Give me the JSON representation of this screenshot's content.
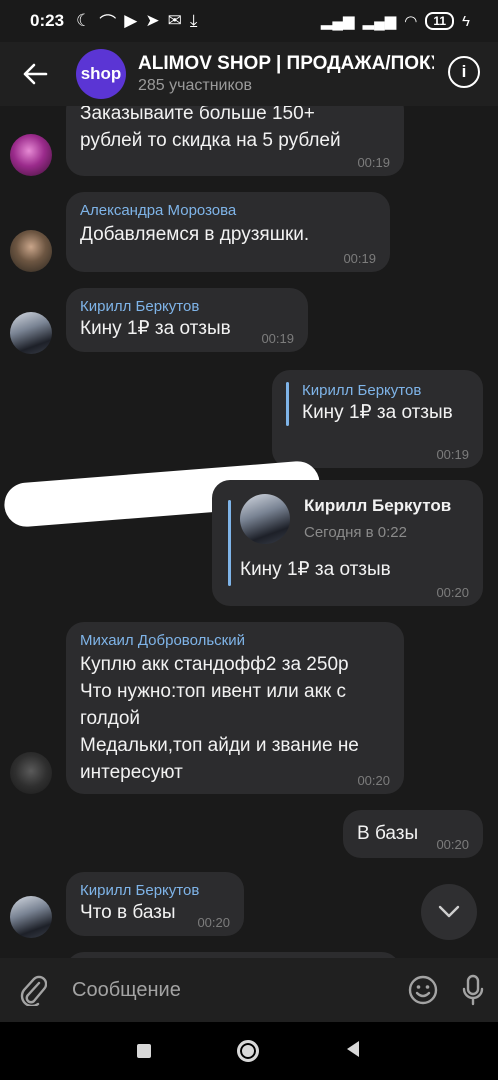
{
  "status_bar": {
    "time": "0:23",
    "battery": "11"
  },
  "header": {
    "avatar_text": "shop",
    "title": "ALIMOV SHOP | ПРОДАЖА/ПОКУПКА",
    "subtitle": "285 участников"
  },
  "messages": [
    {
      "text": "Заказываите больше 150+\nрублей то скидка на 5 рублей",
      "time": "00:19"
    },
    {
      "sender": "Александра Морозова",
      "text": "Добавляемся в друзяшки.",
      "time": "00:19"
    },
    {
      "sender": "Кирилл Беркутов",
      "text": "Кину 1₽ за отзыв",
      "time": "00:19"
    },
    {
      "quote_sender": "Кирилл Беркутов",
      "quote_text": "Кину 1₽ за отзыв",
      "time": "00:19"
    },
    {
      "forward_sender": "Кирилл Беркутов",
      "forward_date": "Сегодня в 0:22",
      "text": "Кину 1₽ за отзыв",
      "time": "00:20"
    },
    {
      "sender": "Михаил Добровольский",
      "text": "Куплю акк стандофф2 за 250р\nЧто нужно:топ ивент или акк с\nголдой\nМедальки,топ айди и звание не\nинтересуют",
      "time": "00:20"
    },
    {
      "text": "В базы",
      "time": "00:20"
    },
    {
      "sender": "Кирилл Беркутов",
      "text": "Что в базы",
      "time": "00:20"
    }
  ],
  "composer": {
    "placeholder": "Сообщение"
  }
}
